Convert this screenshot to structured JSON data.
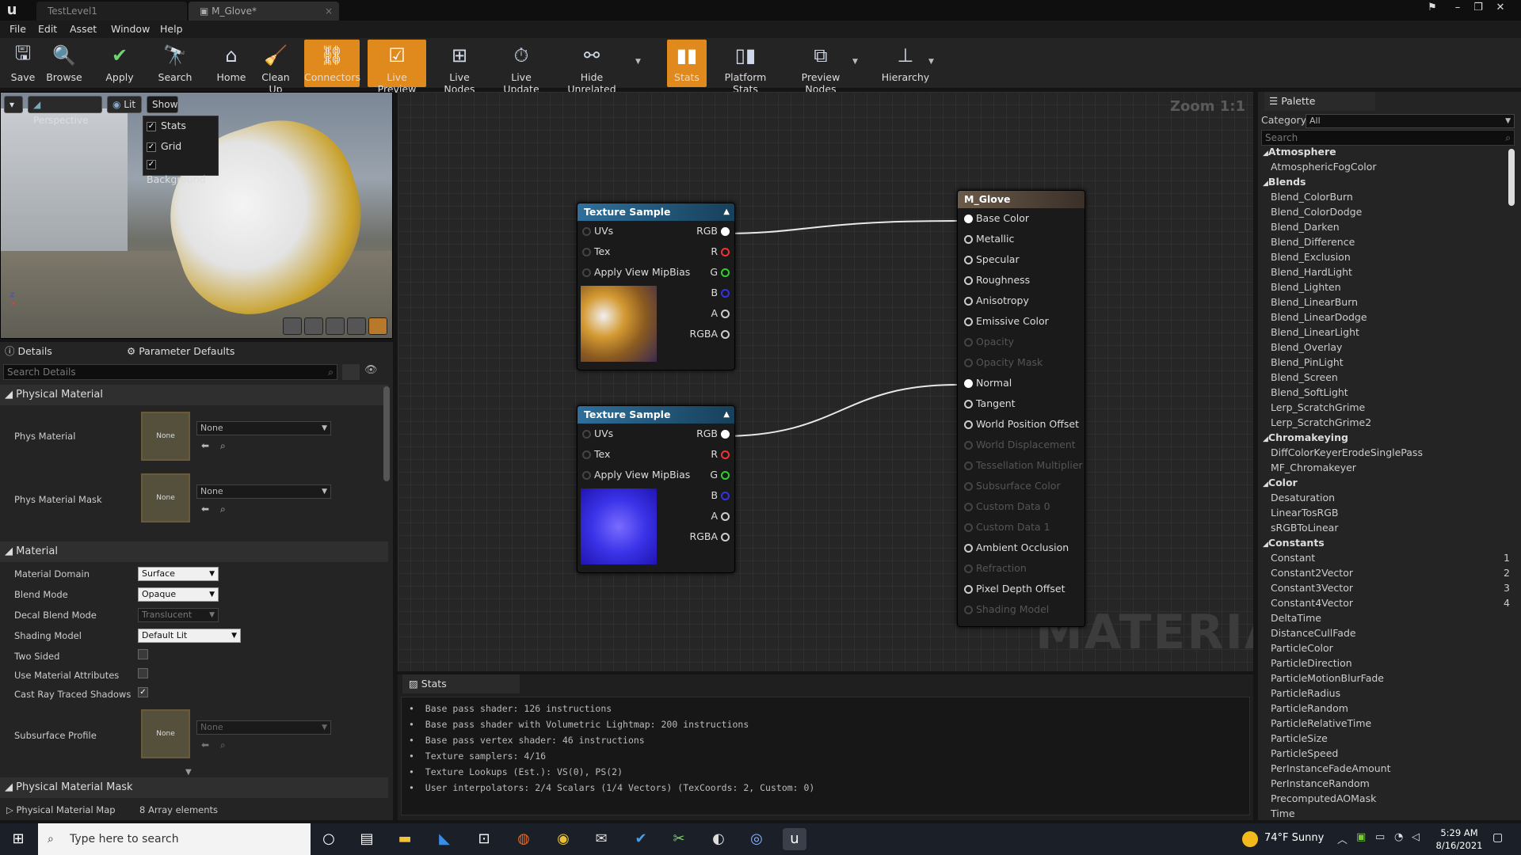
{
  "tabs": [
    {
      "label": "TestLevel1"
    },
    {
      "label": "M_Glove*"
    }
  ],
  "menu": [
    "File",
    "Edit",
    "Asset",
    "Window",
    "Help"
  ],
  "toolbar": [
    {
      "label": "Save",
      "icon": "save-icon"
    },
    {
      "label": "Browse",
      "icon": "browse-icon"
    },
    {
      "label": "Apply",
      "icon": "apply-icon"
    },
    {
      "label": "Search",
      "icon": "search-icon"
    },
    {
      "label": "Home",
      "icon": "home-icon"
    },
    {
      "label": "Clean Up",
      "icon": "clean-up-icon"
    },
    {
      "label": "Connectors",
      "icon": "connectors-icon"
    },
    {
      "label": "Live Preview",
      "icon": "live-preview-icon"
    },
    {
      "label": "Live Nodes",
      "icon": "live-nodes-icon"
    },
    {
      "label": "Live Update",
      "icon": "live-update-icon"
    },
    {
      "label": "Hide Unrelated",
      "icon": "hide-unrelated-icon"
    },
    {
      "label": "Stats",
      "icon": "stats-icon"
    },
    {
      "label": "Platform Stats",
      "icon": "platform-stats-icon"
    },
    {
      "label": "Preview Nodes",
      "icon": "preview-nodes-icon"
    },
    {
      "label": "Hierarchy",
      "icon": "hierarchy-icon"
    }
  ],
  "viewport": {
    "perspective": "Perspective",
    "lit": "Lit",
    "show": "Show",
    "show_menu": [
      "Stats",
      "Grid",
      "Background"
    ]
  },
  "details": {
    "tab_details": "Details",
    "tab_params": "Parameter Defaults",
    "search_placeholder": "Search Details",
    "sect_phys": "Physical Material",
    "phys_material": "Phys Material",
    "phys_material_mask": "Phys Material Mask",
    "none": "None",
    "sect_material": "Material",
    "rows": [
      {
        "label": "Material Domain",
        "value": "Surface"
      },
      {
        "label": "Blend Mode",
        "value": "Opaque"
      },
      {
        "label": "Decal Blend Mode",
        "value": "Translucent"
      },
      {
        "label": "Shading Model",
        "value": "Default Lit"
      }
    ],
    "two_sided": "Two Sided",
    "use_attr": "Use Material Attributes",
    "cast_ray": "Cast Ray Traced Shadows",
    "subsurface": "Subsurface Profile",
    "sect_mask": "Physical Material Mask",
    "phys_map": "Physical Material Map",
    "phys_map_value": "8 Array elements"
  },
  "graph": {
    "zoom": "Zoom 1:1",
    "watermark": "MATERIAL",
    "texture_title": "Texture Sample",
    "tex_inputs": [
      "UVs",
      "Tex",
      "Apply View MipBias"
    ],
    "tex_outputs": [
      "RGB",
      "R",
      "G",
      "B",
      "A",
      "RGBA"
    ],
    "result_title": "M_Glove",
    "result_pins": [
      {
        "label": "Base Color",
        "active": true
      },
      {
        "label": "Metallic",
        "active": true
      },
      {
        "label": "Specular",
        "active": true
      },
      {
        "label": "Roughness",
        "active": true
      },
      {
        "label": "Anisotropy",
        "active": true
      },
      {
        "label": "Emissive Color",
        "active": true
      },
      {
        "label": "Opacity",
        "active": false
      },
      {
        "label": "Opacity Mask",
        "active": false
      },
      {
        "label": "Normal",
        "active": true
      },
      {
        "label": "Tangent",
        "active": true
      },
      {
        "label": "World Position Offset",
        "active": true
      },
      {
        "label": "World Displacement",
        "active": false
      },
      {
        "label": "Tessellation Multiplier",
        "active": false
      },
      {
        "label": "Subsurface Color",
        "active": false
      },
      {
        "label": "Custom Data 0",
        "active": false
      },
      {
        "label": "Custom Data 1",
        "active": false
      },
      {
        "label": "Ambient Occlusion",
        "active": true
      },
      {
        "label": "Refraction",
        "active": false
      },
      {
        "label": "Pixel Depth Offset",
        "active": true
      },
      {
        "label": "Shading Model",
        "active": false
      }
    ]
  },
  "stats": {
    "tab": "Stats",
    "lines": [
      "Base pass shader: 126 instructions",
      "Base pass shader with Volumetric Lightmap: 200 instructions",
      "Base pass vertex shader: 46 instructions",
      "Texture samplers: 4/16",
      "Texture Lookups (Est.): VS(0), PS(2)",
      "User interpolators: 2/4 Scalars (1/4 Vectors) (TexCoords: 2, Custom: 0)"
    ]
  },
  "palette": {
    "tab": "Palette",
    "category_label": "Category:",
    "category_value": "All",
    "search_placeholder": "Search",
    "items": [
      {
        "t": "cat",
        "label": "Atmosphere"
      },
      {
        "t": "item",
        "label": "AtmosphericFogColor"
      },
      {
        "t": "cat",
        "label": "Blends"
      },
      {
        "t": "item",
        "label": "Blend_ColorBurn"
      },
      {
        "t": "item",
        "label": "Blend_ColorDodge"
      },
      {
        "t": "item",
        "label": "Blend_Darken"
      },
      {
        "t": "item",
        "label": "Blend_Difference"
      },
      {
        "t": "item",
        "label": "Blend_Exclusion"
      },
      {
        "t": "item",
        "label": "Blend_HardLight"
      },
      {
        "t": "item",
        "label": "Blend_Lighten"
      },
      {
        "t": "item",
        "label": "Blend_LinearBurn"
      },
      {
        "t": "item",
        "label": "Blend_LinearDodge"
      },
      {
        "t": "item",
        "label": "Blend_LinearLight"
      },
      {
        "t": "item",
        "label": "Blend_Overlay"
      },
      {
        "t": "item",
        "label": "Blend_PinLight"
      },
      {
        "t": "item",
        "label": "Blend_Screen"
      },
      {
        "t": "item",
        "label": "Blend_SoftLight"
      },
      {
        "t": "item",
        "label": "Lerp_ScratchGrime"
      },
      {
        "t": "item",
        "label": "Lerp_ScratchGrime2"
      },
      {
        "t": "cat",
        "label": "Chromakeying"
      },
      {
        "t": "item",
        "label": "DiffColorKeyerErodeSinglePass"
      },
      {
        "t": "item",
        "label": "MF_Chromakeyer"
      },
      {
        "t": "cat",
        "label": "Color"
      },
      {
        "t": "item",
        "label": "Desaturation"
      },
      {
        "t": "item",
        "label": "LinearTosRGB"
      },
      {
        "t": "item",
        "label": "sRGBToLinear"
      },
      {
        "t": "cat",
        "label": "Constants"
      },
      {
        "t": "item",
        "label": "Constant",
        "num": "1"
      },
      {
        "t": "item",
        "label": "Constant2Vector",
        "num": "2"
      },
      {
        "t": "item",
        "label": "Constant3Vector",
        "num": "3"
      },
      {
        "t": "item",
        "label": "Constant4Vector",
        "num": "4"
      },
      {
        "t": "item",
        "label": "DeltaTime"
      },
      {
        "t": "item",
        "label": "DistanceCullFade"
      },
      {
        "t": "item",
        "label": "ParticleColor"
      },
      {
        "t": "item",
        "label": "ParticleDirection"
      },
      {
        "t": "item",
        "label": "ParticleMotionBlurFade"
      },
      {
        "t": "item",
        "label": "ParticleRadius"
      },
      {
        "t": "item",
        "label": "ParticleRandom"
      },
      {
        "t": "item",
        "label": "ParticleRelativeTime"
      },
      {
        "t": "item",
        "label": "ParticleSize"
      },
      {
        "t": "item",
        "label": "ParticleSpeed"
      },
      {
        "t": "item",
        "label": "PerInstanceFadeAmount"
      },
      {
        "t": "item",
        "label": "PerInstanceRandom"
      },
      {
        "t": "item",
        "label": "PrecomputedAOMask"
      },
      {
        "t": "item",
        "label": "Time"
      }
    ]
  },
  "taskbar": {
    "search_placeholder": "Type here to search",
    "weather": "74°F  Sunny",
    "time": "5:29 AM",
    "date": "8/16/2021"
  }
}
